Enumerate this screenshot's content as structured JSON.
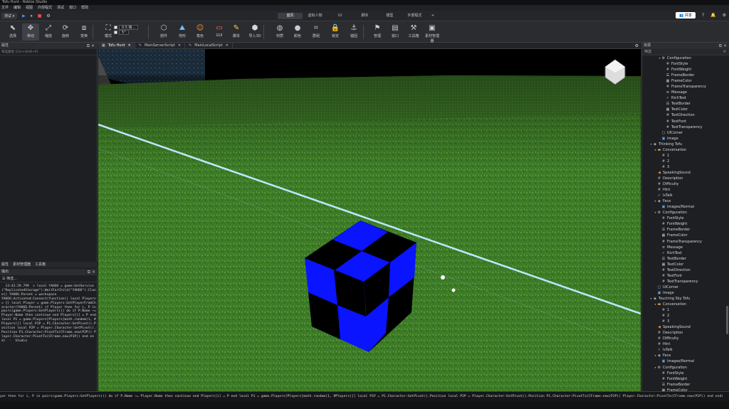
{
  "window": {
    "title": "Tofu Hunt - Roblox Studio"
  },
  "menu": [
    "文件",
    "编辑",
    "视图",
    "外部程式",
    "测试",
    "窗口",
    "帮助"
  ],
  "topbar": {
    "test_dropdown": "测试 ▾",
    "tabs": [
      "首页",
      "虚拟人物",
      "UI",
      "脚本",
      "模型",
      "外部程式",
      "+"
    ],
    "active_tab": "首页",
    "share_label": "共享"
  },
  "ribbon": {
    "buttons": [
      {
        "label": "选择",
        "icon": "cursor-icon"
      },
      {
        "label": "移动",
        "icon": "move-icon"
      },
      {
        "label": "缩放",
        "icon": "scale-icon"
      },
      {
        "label": "旋转",
        "icon": "rotate-icon"
      },
      {
        "label": "变换",
        "icon": "transform-icon"
      },
      {
        "label": "模式",
        "icon": "mode-icon"
      },
      {
        "label": "部件",
        "icon": "part-icon"
      },
      {
        "label": "地形",
        "icon": "terrain-icon"
      },
      {
        "label": "角色",
        "icon": "character-icon"
      },
      {
        "label": "GUI",
        "icon": "gui-icon"
      },
      {
        "label": "脚本",
        "icon": "script-icon"
      },
      {
        "label": "导入3D",
        "icon": "import3d-icon"
      },
      {
        "label": "材质",
        "icon": "material-icon"
      },
      {
        "label": "颜色",
        "icon": "color-icon"
      },
      {
        "label": "群组",
        "icon": "group-icon"
      },
      {
        "label": "锁定",
        "icon": "lock-icon"
      },
      {
        "label": "锚固",
        "icon": "anchor-icon"
      },
      {
        "label": "管理",
        "icon": "manage-icon"
      },
      {
        "label": "窗口",
        "icon": "window-icon"
      },
      {
        "label": "工具箱",
        "icon": "toolbox-icon"
      },
      {
        "label": "素材管理器",
        "icon": "asset-manager-icon"
      }
    ],
    "options": {
      "snap_move": "0.5 格...",
      "snap_rotate": "5°"
    }
  },
  "left_panel": {
    "properties_title": "属性",
    "filter_placeholder": "筛选属性 (Ctrl+Shift+P)",
    "bottom_tabs": [
      "属性",
      "素材管理器",
      "工具箱"
    ],
    "output_title": "输出",
    "output_filter": "筛选...",
    "output_text": "  13:42:29.799  > local YAHOO = game:GetService(\"ReplicatedStorage\"):WaitForChild(\"YAHOO\"):Clone() YAHOO.Parent = workspace\nYAHOO.Activated:Connect(function() local Players = {} local Player = game.Players:GetPlayerFromCharacter(YAHOO.Parent) if Player then for i, P in pairs(game.Players:GetPlayers()) do if P.Name ~= Player.Name then continue end Players[i] = P end local P1 = game.Players[Players[math.random(1, #Players)]] local P1P = P1.Character:GetPivot().Position local P2P = Player.Character:GetPivot().Position P1.Character:PivotTo(CFrame.new(P2P)) Player.Character:PivotTo(CFrame.new(P1P)) end end)  -  Studio"
  },
  "doc_tabs": [
    {
      "label": "Tofu Hunt",
      "active": true
    },
    {
      "label": "MainServerScript",
      "active": false
    },
    {
      "label": "MainLocalScript",
      "active": false
    }
  ],
  "explorer": {
    "title": "资源",
    "filter_placeholder": "筛选",
    "rows": [
      {
        "indent": 3,
        "twisty": "▾",
        "icon": "gear-icon",
        "glyph": "⚙",
        "color": "#c8c8c8",
        "label": "Configuration"
      },
      {
        "indent": 4,
        "twisty": "",
        "icon": "number-icon",
        "glyph": "#",
        "color": "#aab",
        "label": "FontStyle"
      },
      {
        "indent": 4,
        "twisty": "",
        "icon": "number-icon",
        "glyph": "#",
        "color": "#aab",
        "label": "FontWeight"
      },
      {
        "indent": 4,
        "twisty": "",
        "icon": "bool-icon",
        "glyph": "☰",
        "color": "#ccc",
        "label": "FrameBorder"
      },
      {
        "indent": 4,
        "twisty": "",
        "icon": "color3-icon",
        "glyph": "▦",
        "color": "#ccc",
        "label": "FrameColor"
      },
      {
        "indent": 4,
        "twisty": "",
        "icon": "number-icon",
        "glyph": "#",
        "color": "#aab",
        "label": "FrameTransparency"
      },
      {
        "indent": 4,
        "twisty": "",
        "icon": "string-icon",
        "glyph": "≡",
        "color": "#ccc",
        "label": "Message"
      },
      {
        "indent": 4,
        "twisty": "",
        "icon": "bool-icon",
        "glyph": "✓",
        "color": "#ccc",
        "label": "RichText"
      },
      {
        "indent": 4,
        "twisty": "",
        "icon": "bool-icon",
        "glyph": "☰",
        "color": "#ccc",
        "label": "TextBorder"
      },
      {
        "indent": 4,
        "twisty": "",
        "icon": "color3-icon",
        "glyph": "▦",
        "color": "#ccc",
        "label": "TextColor"
      },
      {
        "indent": 4,
        "twisty": "",
        "icon": "number-icon",
        "glyph": "#",
        "color": "#aab",
        "label": "TextDirection"
      },
      {
        "indent": 4,
        "twisty": "",
        "icon": "number-icon",
        "glyph": "#",
        "color": "#aab",
        "label": "TextFont"
      },
      {
        "indent": 4,
        "twisty": "",
        "icon": "number-icon",
        "glyph": "#",
        "color": "#aab",
        "label": "TextTransparency"
      },
      {
        "indent": 3,
        "twisty": "",
        "icon": "uicorner-icon",
        "glyph": "▢",
        "color": "#ccc",
        "label": "UICorner"
      },
      {
        "indent": 3,
        "twisty": "",
        "icon": "image-icon",
        "glyph": "▣",
        "color": "#6ab0ff",
        "label": "Image"
      },
      {
        "indent": 1,
        "twisty": "▾",
        "icon": "model-icon",
        "glyph": "◈",
        "color": "#ccc",
        "label": "Thinking Tofu"
      },
      {
        "indent": 2,
        "twisty": "▾",
        "icon": "folder-icon",
        "glyph": "▬",
        "color": "#e8b84a",
        "label": "Conversation"
      },
      {
        "indent": 3,
        "twisty": "",
        "icon": "number-icon",
        "glyph": "#",
        "color": "#aab",
        "label": "1"
      },
      {
        "indent": 3,
        "twisty": "",
        "icon": "number-icon",
        "glyph": "#",
        "color": "#aab",
        "label": "2"
      },
      {
        "indent": 3,
        "twisty": "",
        "icon": "number-icon",
        "glyph": "#",
        "color": "#aab",
        "label": "3"
      },
      {
        "indent": 2,
        "twisty": "",
        "icon": "sound-icon",
        "glyph": "◀",
        "color": "#e8884a",
        "label": "SpeakingSound"
      },
      {
        "indent": 2,
        "twisty": "",
        "icon": "string-icon",
        "glyph": "#",
        "color": "#aab",
        "label": "Description"
      },
      {
        "indent": 2,
        "twisty": "",
        "icon": "number-icon",
        "glyph": "#",
        "color": "#aab",
        "label": "Difficulty"
      },
      {
        "indent": 2,
        "twisty": "",
        "icon": "number-icon",
        "glyph": "#",
        "color": "#aab",
        "label": "Hint"
      },
      {
        "indent": 2,
        "twisty": "",
        "icon": "bool-icon",
        "glyph": "✓",
        "color": "#ccc",
        "label": "IsTalk"
      },
      {
        "indent": 2,
        "twisty": "▾",
        "icon": "model-icon",
        "glyph": "◈",
        "color": "#ccc",
        "label": "Face"
      },
      {
        "indent": 3,
        "twisty": "",
        "icon": "image-icon",
        "glyph": "▣",
        "color": "#6ab0ff",
        "label": "Images/Normal"
      },
      {
        "indent": 2,
        "twisty": "▾",
        "icon": "gear-icon",
        "glyph": "⚙",
        "color": "#c8c8c8",
        "label": "Configuration"
      },
      {
        "indent": 3,
        "twisty": "",
        "icon": "number-icon",
        "glyph": "#",
        "color": "#aab",
        "label": "FontStyle"
      },
      {
        "indent": 3,
        "twisty": "",
        "icon": "number-icon",
        "glyph": "#",
        "color": "#aab",
        "label": "FontWeight"
      },
      {
        "indent": 3,
        "twisty": "",
        "icon": "bool-icon",
        "glyph": "☰",
        "color": "#ccc",
        "label": "FrameBorder"
      },
      {
        "indent": 3,
        "twisty": "",
        "icon": "color3-icon",
        "glyph": "▦",
        "color": "#ccc",
        "label": "FrameColor"
      },
      {
        "indent": 3,
        "twisty": "",
        "icon": "number-icon",
        "glyph": "#",
        "color": "#aab",
        "label": "FrameTransparency"
      },
      {
        "indent": 3,
        "twisty": "",
        "icon": "string-icon",
        "glyph": "≡",
        "color": "#ccc",
        "label": "Message"
      },
      {
        "indent": 3,
        "twisty": "",
        "icon": "bool-icon",
        "glyph": "✓",
        "color": "#ccc",
        "label": "RichText"
      },
      {
        "indent": 3,
        "twisty": "",
        "icon": "bool-icon",
        "glyph": "☰",
        "color": "#ccc",
        "label": "TextBorder"
      },
      {
        "indent": 3,
        "twisty": "",
        "icon": "color3-icon",
        "glyph": "▦",
        "color": "#ccc",
        "label": "TextColor"
      },
      {
        "indent": 3,
        "twisty": "",
        "icon": "number-icon",
        "glyph": "#",
        "color": "#aab",
        "label": "TextDirection"
      },
      {
        "indent": 3,
        "twisty": "",
        "icon": "number-icon",
        "glyph": "#",
        "color": "#aab",
        "label": "TextFont"
      },
      {
        "indent": 3,
        "twisty": "",
        "icon": "number-icon",
        "glyph": "#",
        "color": "#aab",
        "label": "TextTransparency"
      },
      {
        "indent": 2,
        "twisty": "",
        "icon": "uicorner-icon",
        "glyph": "▢",
        "color": "#ccc",
        "label": "UICorner"
      },
      {
        "indent": 2,
        "twisty": "",
        "icon": "image-icon",
        "glyph": "▣",
        "color": "#6ab0ff",
        "label": "Image"
      },
      {
        "indent": 1,
        "twisty": "▾",
        "icon": "model-icon",
        "glyph": "◈",
        "color": "#ccc",
        "label": "Touching Sky Tofu"
      },
      {
        "indent": 2,
        "twisty": "▾",
        "icon": "folder-icon",
        "glyph": "▬",
        "color": "#e8b84a",
        "label": "Conversation"
      },
      {
        "indent": 3,
        "twisty": "",
        "icon": "number-icon",
        "glyph": "#",
        "color": "#aab",
        "label": "1"
      },
      {
        "indent": 3,
        "twisty": "",
        "icon": "number-icon",
        "glyph": "#",
        "color": "#aab",
        "label": "2"
      },
      {
        "indent": 3,
        "twisty": "",
        "icon": "number-icon",
        "glyph": "#",
        "color": "#aab",
        "label": "3"
      },
      {
        "indent": 2,
        "twisty": "",
        "icon": "sound-icon",
        "glyph": "◀",
        "color": "#e8884a",
        "label": "SpeakingSound"
      },
      {
        "indent": 2,
        "twisty": "",
        "icon": "string-icon",
        "glyph": "#",
        "color": "#aab",
        "label": "Description"
      },
      {
        "indent": 2,
        "twisty": "",
        "icon": "number-icon",
        "glyph": "#",
        "color": "#aab",
        "label": "Difficulty"
      },
      {
        "indent": 2,
        "twisty": "",
        "icon": "number-icon",
        "glyph": "#",
        "color": "#aab",
        "label": "Hint"
      },
      {
        "indent": 2,
        "twisty": "",
        "icon": "bool-icon",
        "glyph": "✓",
        "color": "#ccc",
        "label": "IsTalk"
      },
      {
        "indent": 2,
        "twisty": "▾",
        "icon": "model-icon",
        "glyph": "◈",
        "color": "#ccc",
        "label": "Face"
      },
      {
        "indent": 3,
        "twisty": "",
        "icon": "image-icon",
        "glyph": "▣",
        "color": "#6ab0ff",
        "label": "Images/Normal"
      },
      {
        "indent": 2,
        "twisty": "▾",
        "icon": "gear-icon",
        "glyph": "⚙",
        "color": "#c8c8c8",
        "label": "Configuration"
      },
      {
        "indent": 3,
        "twisty": "",
        "icon": "number-icon",
        "glyph": "#",
        "color": "#aab",
        "label": "FontStyle"
      },
      {
        "indent": 3,
        "twisty": "",
        "icon": "number-icon",
        "glyph": "#",
        "color": "#aab",
        "label": "FontWeight"
      },
      {
        "indent": 3,
        "twisty": "",
        "icon": "bool-icon",
        "glyph": "☰",
        "color": "#ccc",
        "label": "FrameBorder"
      },
      {
        "indent": 3,
        "twisty": "",
        "icon": "color3-icon",
        "glyph": "▦",
        "color": "#ccc",
        "label": "FrameColor"
      }
    ]
  },
  "command_bar": {
    "text": "yer then for i, P in pairs(game.Players:GetPlayers()) do if P.Name ~= Player.Name then continue end Players[i] = P end local P1 = game.Players[Players[math.random(1, #Players)]] local P1P = P1.Character:GetPivot().Position local P2P = Player.Character:GetPivot().Position P1.Character:PivotTo(CFrame.new(P2P)) Player.Character:PivotTo(CFrame.new(P1P)) end end)"
  },
  "colors": {
    "cube_blue": "#0a14ff",
    "grass": "#3f7a2a",
    "sky": "#000000",
    "accent": "#4a8cff"
  }
}
